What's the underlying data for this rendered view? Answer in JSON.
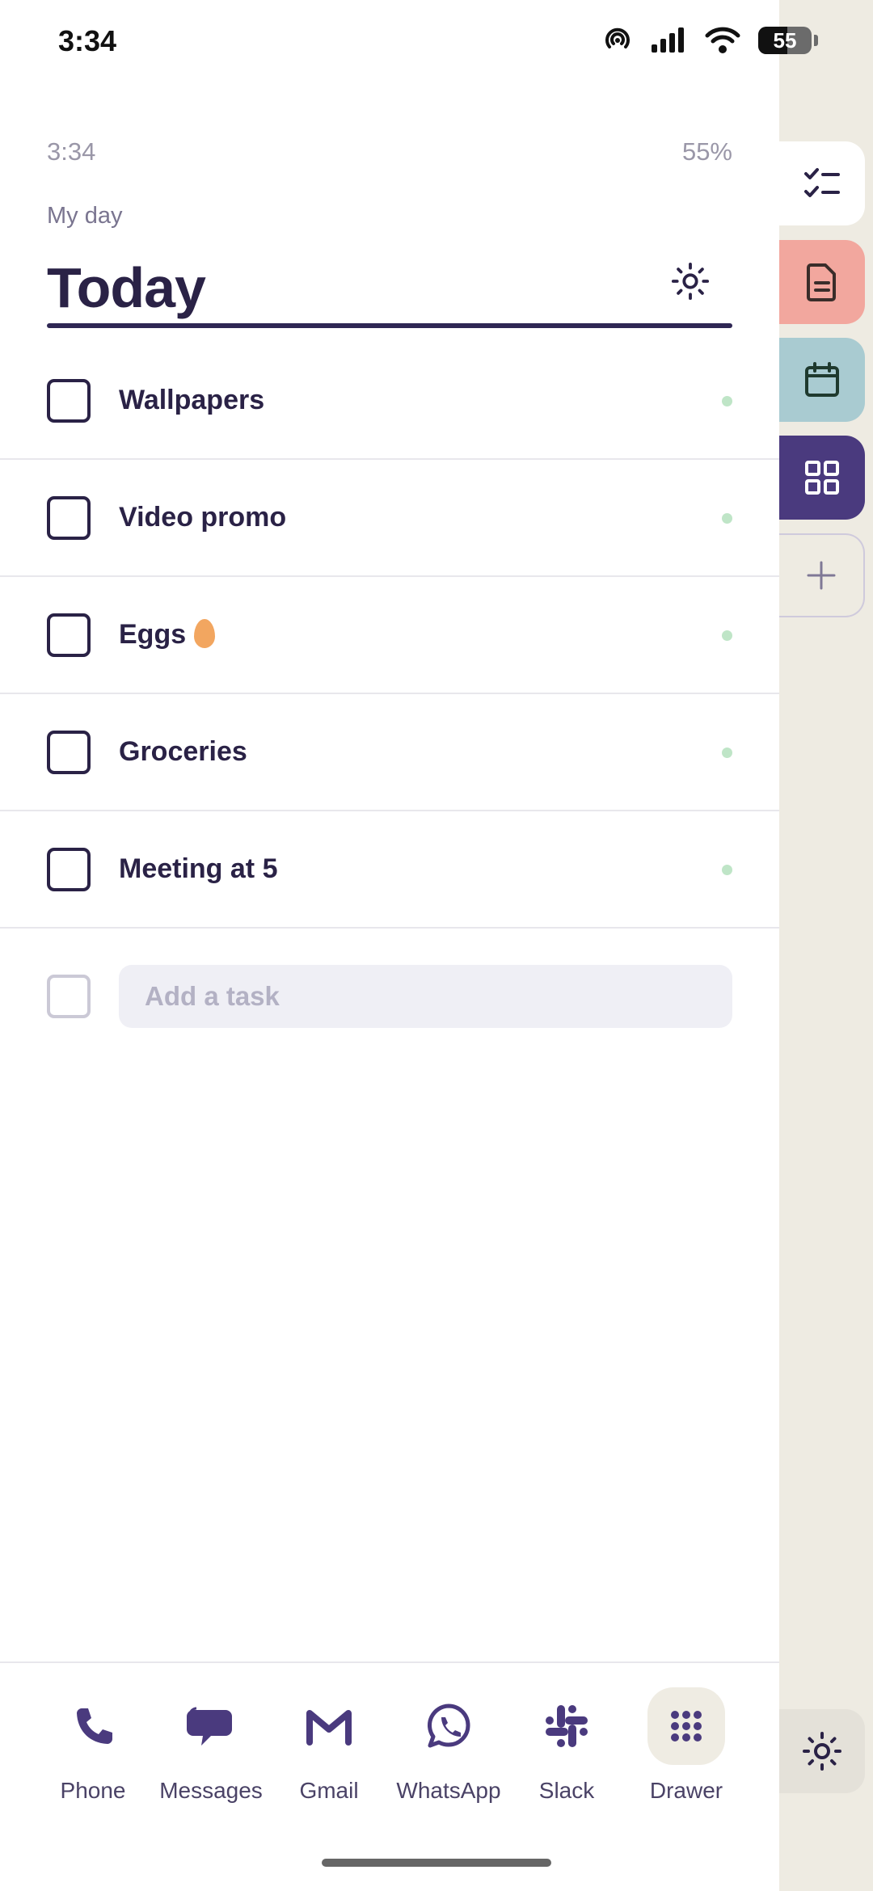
{
  "status_bar": {
    "time": "3:34",
    "battery_text": "55",
    "battery_level": 0.55
  },
  "widget": {
    "time": "3:34",
    "battery": "55%"
  },
  "header": {
    "section_label": "My day",
    "title": "Today",
    "theme_icon": "sun-icon"
  },
  "tasks": [
    {
      "label": "Wallpapers",
      "done": false,
      "emoji": ""
    },
    {
      "label": "Video promo",
      "done": false,
      "emoji": ""
    },
    {
      "label": "Eggs",
      "done": false,
      "emoji": "egg"
    },
    {
      "label": "Groceries",
      "done": false,
      "emoji": ""
    },
    {
      "label": "Meeting at 5",
      "done": false,
      "emoji": ""
    }
  ],
  "add_task": {
    "placeholder": "Add a task",
    "value": ""
  },
  "dock": {
    "apps": [
      {
        "label": "Phone",
        "icon": "phone-icon"
      },
      {
        "label": "Messages",
        "icon": "messages-icon"
      },
      {
        "label": "Gmail",
        "icon": "gmail-icon"
      },
      {
        "label": "WhatsApp",
        "icon": "whatsapp-icon"
      },
      {
        "label": "Slack",
        "icon": "slack-icon"
      },
      {
        "label": "Drawer",
        "icon": "grid-icon"
      }
    ]
  },
  "rail": {
    "tabs": [
      {
        "icon": "checklist-icon",
        "color": "#ffffff",
        "active": true
      },
      {
        "icon": "document-icon",
        "color": "#f2a79e",
        "active": false
      },
      {
        "icon": "calendar-icon",
        "color": "#a9cbd1",
        "active": false
      },
      {
        "icon": "apps-grid-icon",
        "color": "#4a3a7e",
        "active": false
      },
      {
        "icon": "plus-icon",
        "color": "#eeebe2",
        "active": false
      }
    ],
    "bottom_icon": "sun-icon"
  },
  "colors": {
    "accent": "#2a2246",
    "dock_icon": "#4a3a7e",
    "task_dot": "#bfe5c7",
    "rail_background": "#eeebe2"
  }
}
